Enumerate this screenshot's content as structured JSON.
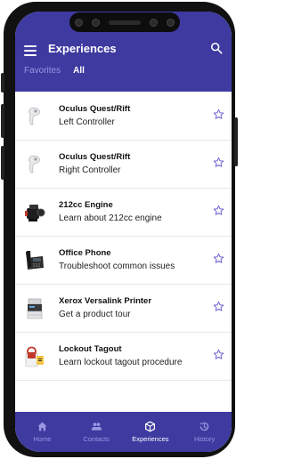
{
  "header": {
    "title": "Experiences"
  },
  "tabs": [
    {
      "label": "Favorites",
      "active": false
    },
    {
      "label": "All",
      "active": true
    }
  ],
  "items": [
    {
      "title": "Oculus Quest/Rift",
      "subtitle": "Left Controller",
      "icon": "vr-controller-icon",
      "favorite": false
    },
    {
      "title": "Oculus Quest/Rift",
      "subtitle": "Right Controller",
      "icon": "vr-controller-icon",
      "favorite": false
    },
    {
      "title": "212cc Engine",
      "subtitle": "Learn about 212cc engine",
      "icon": "engine-icon",
      "favorite": false
    },
    {
      "title": "Office Phone",
      "subtitle": "Troubleshoot common issues",
      "icon": "desk-phone-icon",
      "favorite": false
    },
    {
      "title": "Xerox Versalink Printer",
      "subtitle": "Get a product tour",
      "icon": "printer-icon",
      "favorite": false
    },
    {
      "title": "Lockout Tagout",
      "subtitle": "Learn lockout tagout procedure",
      "icon": "lockout-tag-icon",
      "favorite": false
    }
  ],
  "nav": [
    {
      "label": "Home",
      "icon": "home-icon",
      "active": false
    },
    {
      "label": "Contacts",
      "icon": "contacts-icon",
      "active": false
    },
    {
      "label": "Experiences",
      "icon": "experiences-icon",
      "active": true
    },
    {
      "label": "History",
      "icon": "history-icon",
      "active": false
    }
  ],
  "colors": {
    "primary": "#3e3aa0",
    "inactive": "#9b97e2",
    "star": "#6b66c9"
  }
}
